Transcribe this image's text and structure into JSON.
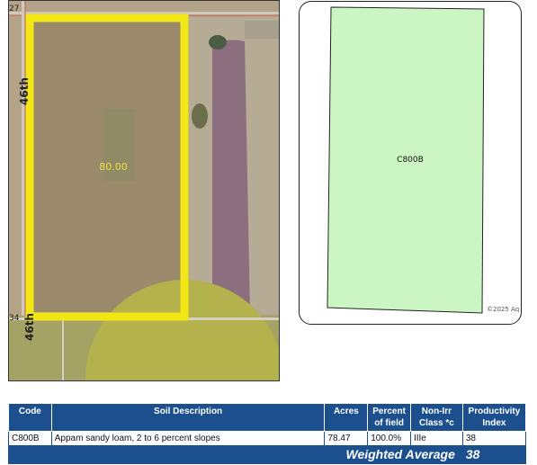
{
  "aerial": {
    "field_acres_label": "80.00",
    "road_number_top": "27",
    "road_number_bottom": "34",
    "road_label_upper": "46th",
    "road_label_lower": "46th"
  },
  "soil_map": {
    "unit_label": "C800B",
    "copyright": "©2025 Aq",
    "fill_color": "#ccf5c4"
  },
  "soil_table": {
    "headers": {
      "code": "Code",
      "description": "Soil Description",
      "acres": "Acres",
      "percent": "Percent of field",
      "class": "Non-Irr Class *c",
      "productivity": "Productivity Index"
    },
    "rows": [
      {
        "code": "C800B",
        "description": "Appam sandy loam, 2 to 6 percent slopes",
        "acres": "78.47",
        "percent": "100.0%",
        "class": "IIIe",
        "productivity": "38"
      }
    ],
    "weighted_average_label": "Weighted Average",
    "weighted_average_value": "38"
  },
  "colors": {
    "highlight_yellow": "#f2e614",
    "table_header_blue": "#1b4f8e"
  }
}
